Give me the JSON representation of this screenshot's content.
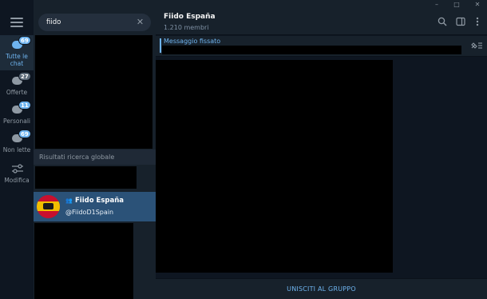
{
  "sidebar": {
    "folders": [
      {
        "label": "Tutte le chat",
        "badge": "69"
      },
      {
        "label": "Offerte",
        "badge": "27"
      },
      {
        "label": "Personali",
        "badge": "11"
      },
      {
        "label": "Non lette",
        "badge": "69"
      },
      {
        "label": "Modifica"
      }
    ]
  },
  "search": {
    "query": "fiido",
    "global_results_label": "Risultati ricerca globale",
    "result": {
      "title": "Fiido España",
      "username": "@FiidoD1Spain"
    }
  },
  "chat": {
    "title": "Fiido España",
    "subtitle": "1.210 membri",
    "pinned_label": "Messaggio fissato",
    "join_label": "UNISCITI AL GRUPPO"
  },
  "window_controls": {
    "minimize": "–",
    "maximize": "□",
    "close": "✕"
  },
  "colors": {
    "accent": "#6fb4ef",
    "selected_row": "#2b5278",
    "panel": "#17212b",
    "background": "#0e1621"
  }
}
